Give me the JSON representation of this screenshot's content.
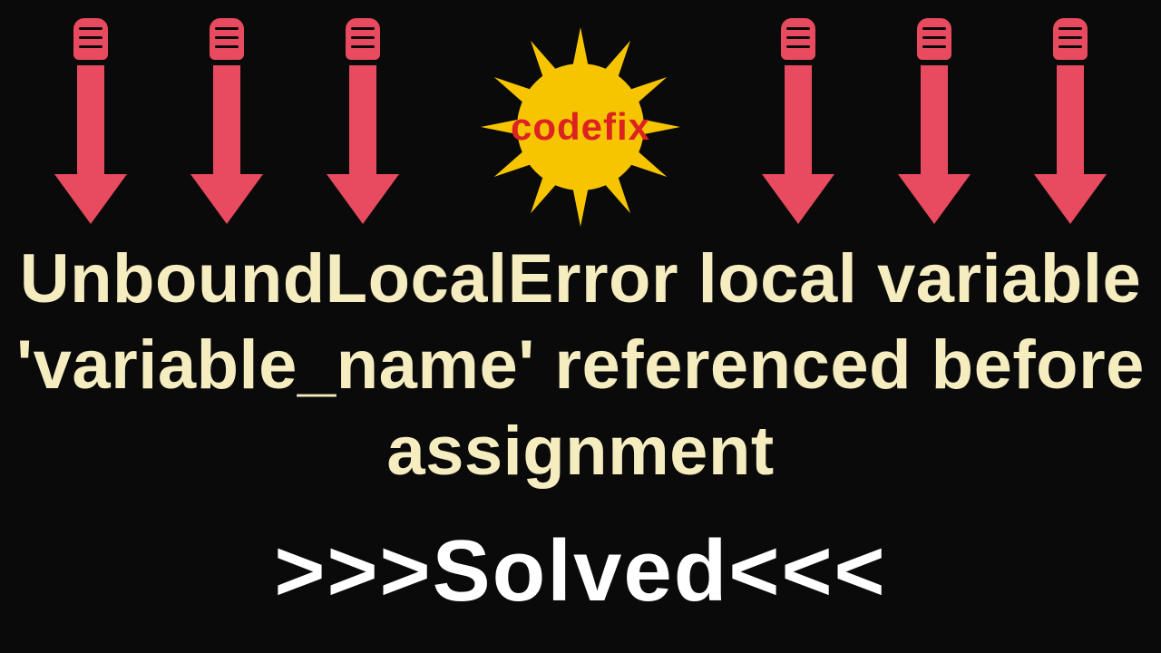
{
  "badge": {
    "label": "codefix"
  },
  "error_message": "UnboundLocalError local variable 'variable_name' referenced before assignment",
  "solved": {
    "prefix": ">>>",
    "word": "Solved",
    "suffix": "<<<"
  },
  "colors": {
    "background": "#0a0a0a",
    "arrow": "#e84a5f",
    "starburst": "#f7c500",
    "badge_text": "#d22",
    "error_text": "#f5ecc0",
    "solved_text": "#ffffff"
  }
}
